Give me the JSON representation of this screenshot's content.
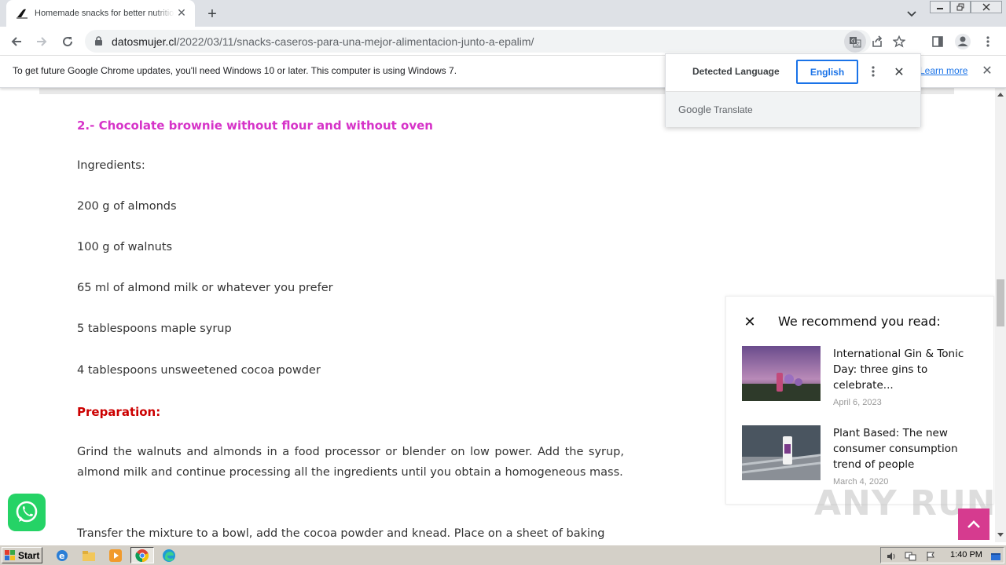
{
  "browser": {
    "tab_title": "Homemade snacks for better nutrition",
    "url_domain": "datosmujer.cl",
    "url_path": "/2022/03/11/snacks-caseros-para-una-mejor-alimentacion-junto-a-epalim/"
  },
  "infobar": {
    "message": "To get future Google Chrome updates, you'll need Windows 10 or later. This computer is using Windows 7.",
    "learn_more": "Learn more"
  },
  "translate": {
    "detected_language": "Detected Language",
    "english": "English",
    "google": "Google",
    "translate": "Translate"
  },
  "article": {
    "heading": "2.- Chocolate brownie without flour and without oven",
    "ingredients_label": "Ingredients:",
    "ingredients": [
      "200 g of almonds",
      "100 g of walnuts",
      "65 ml of almond milk or whatever you prefer",
      "5 tablespoons maple syrup",
      "4 tablespoons unsweetened cocoa powder"
    ],
    "preparation_label": "Preparation:",
    "step1": "Grind the walnuts and almonds in a food processor or blender on low power. Add the syrup, almond milk and continue processing all the ingredients until you obtain a homogeneous mass.",
    "step2": "Transfer the mixture to a bowl, add the cocoa powder and knead. Place on a sheet of baking"
  },
  "recommend": {
    "title": "We recommend you read:",
    "items": [
      {
        "title": "International Gin & Tonic Day: three gins to celebrate...",
        "date": "April 6, 2023"
      },
      {
        "title": "Plant Based: The new consumer consumption trend of people",
        "date": "March 4, 2020"
      }
    ]
  },
  "watermark": "ANY RUN",
  "taskbar": {
    "start": "Start",
    "clock": "1:40 PM"
  }
}
